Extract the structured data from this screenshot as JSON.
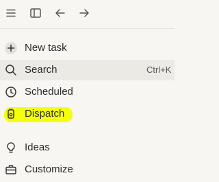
{
  "toolbar": {
    "menu_icon": "hamburger-menu-icon",
    "sidebar_icon": "sidebar-toggle-icon",
    "back_icon": "arrow-left-icon",
    "forward_icon": "arrow-right-icon"
  },
  "nav": {
    "items": [
      {
        "label": "New task",
        "icon": "plus-icon"
      },
      {
        "label": "Search",
        "icon": "search-icon",
        "shortcut": "Ctrl+K",
        "active": true
      },
      {
        "label": "Scheduled",
        "icon": "clock-icon"
      },
      {
        "label": "Dispatch",
        "icon": "dispatch-device-icon",
        "highlighted": true
      },
      {
        "label": "Ideas",
        "icon": "lightbulb-icon"
      },
      {
        "label": "Customize",
        "icon": "briefcase-icon"
      }
    ]
  },
  "colors": {
    "background": "#f7f6f3",
    "active_row": "#eceae5",
    "highlight": "#f3ff00",
    "text": "#2b2b2b"
  }
}
